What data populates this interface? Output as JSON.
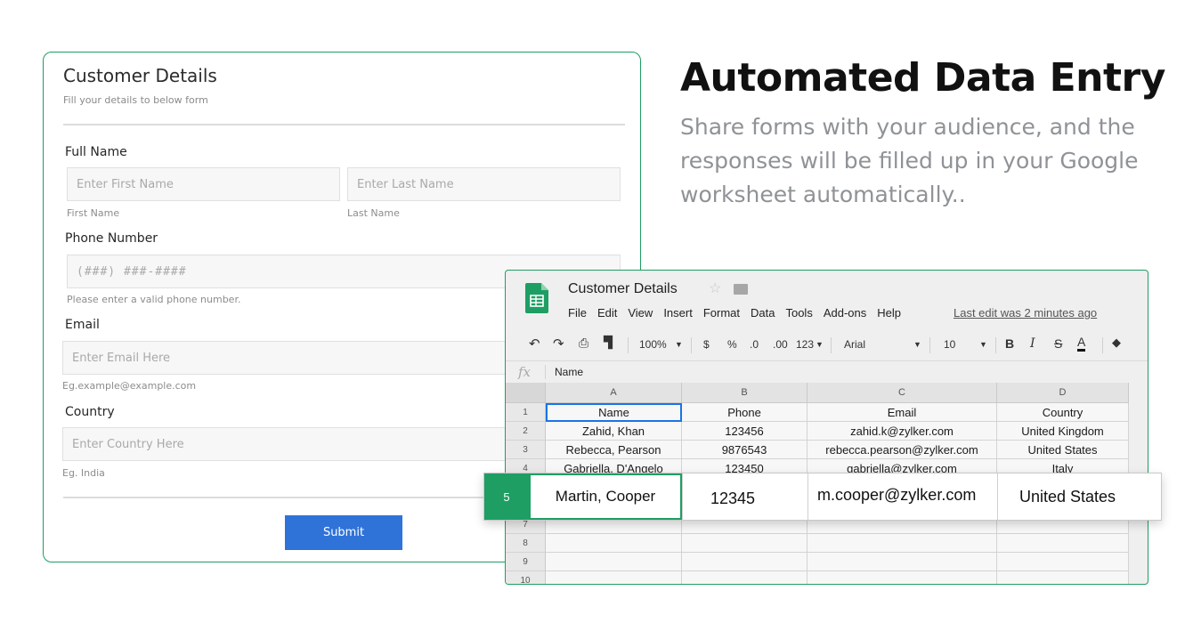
{
  "form": {
    "title": "Customer Details",
    "subtitle": "Fill your details to below form",
    "full_name_label": "Full Name",
    "first_name_placeholder": "Enter First Name",
    "first_name_hint": "First Name",
    "last_name_placeholder": "Enter Last Name",
    "last_name_hint": "Last Name",
    "phone_label": "Phone Number",
    "phone_placeholder": "(###) ###-####",
    "phone_hint": "Please enter a valid phone number.",
    "email_label": "Email",
    "email_placeholder": "Enter Email Here",
    "email_hint": "Eg.example@example.com",
    "country_label": "Country",
    "country_placeholder": "Enter Country Here",
    "country_hint": "Eg. India",
    "submit_label": "Submit"
  },
  "hero": {
    "headline": "Automated Data Entry",
    "subline": "Share forms with your audience, and the responses will be filled up in your Google worksheet automatically.."
  },
  "sheet": {
    "title": "Customer Details",
    "menu": [
      "File",
      "Edit",
      "View",
      "Insert",
      "Format",
      "Data",
      "Tools",
      "Add-ons",
      "Help"
    ],
    "last_edit": "Last edit was 2 minutes ago",
    "toolbar": {
      "zoom": "100%",
      "currency": "$",
      "percent": "%",
      "dec_less": ".0",
      "dec_more": ".00",
      "more_formats": "123",
      "font": "Arial",
      "font_size": "10",
      "bold": "B",
      "italic": "I",
      "strike": "S",
      "text_color": "A"
    },
    "formula_label": "fx",
    "formula_value": "Name",
    "columns": [
      "A",
      "B",
      "C",
      "D"
    ],
    "row_numbers": [
      "1",
      "2",
      "3",
      "4",
      "7",
      "8",
      "9",
      "10"
    ],
    "rows": [
      [
        "Name",
        "Phone",
        "Email",
        "Country"
      ],
      [
        "Zahid, Khan",
        "123456",
        "zahid.k@zylker.com",
        "United Kingdom"
      ],
      [
        "Rebecca, Pearson",
        "9876543",
        "rebecca.pearson@zylker.com",
        "United States"
      ],
      [
        "Gabriella, D'Angelo",
        "123450",
        "gabriella@zylker.com",
        "Italy"
      ]
    ],
    "highlight_row": {
      "number": "5",
      "name": "Martin, Cooper",
      "phone": "12345",
      "email": "m.cooper@zylker.com",
      "country": "United States"
    },
    "colors": {
      "accent": "#1e9e63",
      "select": "#1a73e8"
    }
  }
}
